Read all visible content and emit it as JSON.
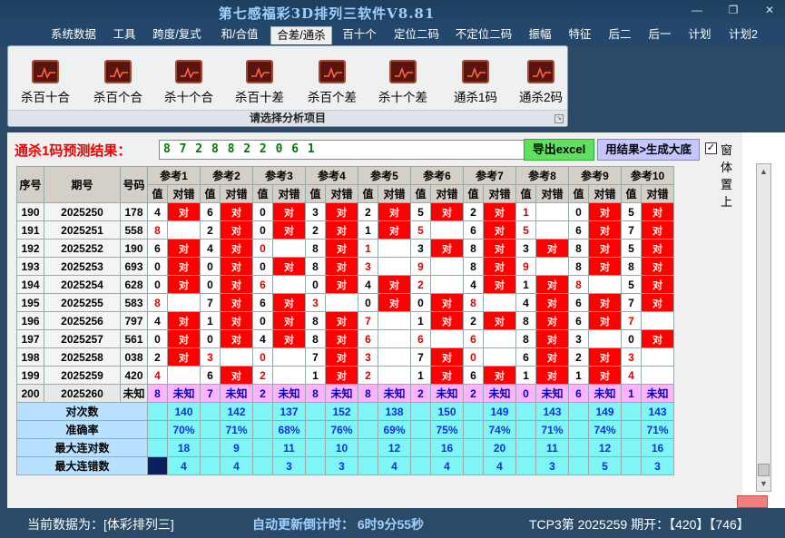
{
  "window": {
    "title": "第七感福彩3D排列三软件V8.81",
    "min_label": "—",
    "max_label": "❐",
    "close_label": "✕"
  },
  "menu": [
    "系统数据",
    "工具",
    "跨度/复式",
    "和/合值",
    "合差/通杀",
    "百十个",
    "定位二码",
    "不定位二码",
    "振幅",
    "特征",
    "后二",
    "后一",
    "计划",
    "计划2"
  ],
  "menu_active_index": 4,
  "ribbon": {
    "buttons": [
      "杀百十合",
      "杀百个合",
      "杀十个合",
      "杀百十差",
      "杀百个差",
      "杀十个差",
      "通杀1码",
      "通杀2码"
    ],
    "caption": "请选择分析项目"
  },
  "prediction": {
    "label": "通杀1码预测结果：",
    "value": "8 7 2 8 8 2 2 0 6 1"
  },
  "buttons": {
    "excel": "导出excel",
    "generate": "用结果>生成大底"
  },
  "checkbox": {
    "label": "窗体置上",
    "checked": true,
    "mark": "✓"
  },
  "table": {
    "col_headers": [
      "序号",
      "期号",
      "号码"
    ],
    "ref_headers": [
      "参考1",
      "参考2",
      "参考3",
      "参考4",
      "参考5",
      "参考6",
      "参考7",
      "参考8",
      "参考9",
      "参考10"
    ],
    "sub_val": "值",
    "sub_res": "对错",
    "hit_text": "对",
    "rows": [
      {
        "seq": "190",
        "period": "2025250",
        "number": "178",
        "vals": [
          "4",
          "6",
          "0",
          "3",
          "2",
          "5",
          "2",
          "1",
          "0",
          "5"
        ],
        "hits": [
          1,
          1,
          1,
          1,
          1,
          1,
          1,
          0,
          1,
          1
        ],
        "red": [
          0,
          0,
          0,
          0,
          0,
          0,
          0,
          1,
          0,
          0
        ]
      },
      {
        "seq": "191",
        "period": "2025251",
        "number": "558",
        "vals": [
          "8",
          "2",
          "0",
          "2",
          "1",
          "5",
          "6",
          "5",
          "6",
          "7"
        ],
        "hits": [
          0,
          1,
          1,
          1,
          1,
          0,
          1,
          0,
          1,
          1
        ],
        "red": [
          1,
          0,
          0,
          0,
          0,
          1,
          0,
          1,
          0,
          0
        ]
      },
      {
        "seq": "192",
        "period": "2025252",
        "number": "190",
        "vals": [
          "6",
          "4",
          "0",
          "8",
          "1",
          "3",
          "8",
          "3",
          "8",
          "5"
        ],
        "hits": [
          1,
          1,
          0,
          1,
          0,
          1,
          1,
          1,
          1,
          1
        ],
        "red": [
          0,
          0,
          1,
          0,
          1,
          0,
          0,
          0,
          0,
          0
        ]
      },
      {
        "seq": "193",
        "period": "2025253",
        "number": "693",
        "vals": [
          "0",
          "0",
          "0",
          "8",
          "3",
          "9",
          "8",
          "9",
          "8",
          "8"
        ],
        "hits": [
          1,
          1,
          1,
          1,
          0,
          0,
          1,
          0,
          1,
          1
        ],
        "red": [
          0,
          0,
          0,
          0,
          1,
          1,
          0,
          1,
          0,
          0
        ]
      },
      {
        "seq": "194",
        "period": "2025254",
        "number": "628",
        "vals": [
          "0",
          "0",
          "6",
          "0",
          "4",
          "2",
          "4",
          "1",
          "8",
          "5"
        ],
        "hits": [
          1,
          1,
          0,
          1,
          1,
          0,
          1,
          1,
          0,
          1
        ],
        "red": [
          0,
          0,
          1,
          0,
          0,
          1,
          0,
          0,
          1,
          0
        ]
      },
      {
        "seq": "195",
        "period": "2025255",
        "number": "583",
        "vals": [
          "8",
          "7",
          "6",
          "3",
          "0",
          "0",
          "8",
          "4",
          "6",
          "7"
        ],
        "hits": [
          0,
          1,
          1,
          0,
          1,
          1,
          0,
          1,
          1,
          1
        ],
        "red": [
          1,
          0,
          0,
          1,
          0,
          0,
          1,
          0,
          0,
          0
        ]
      },
      {
        "seq": "196",
        "period": "2025256",
        "number": "797",
        "vals": [
          "4",
          "1",
          "0",
          "8",
          "7",
          "1",
          "2",
          "8",
          "6",
          "7"
        ],
        "hits": [
          1,
          1,
          1,
          1,
          0,
          1,
          1,
          1,
          1,
          0
        ],
        "red": [
          0,
          0,
          0,
          0,
          1,
          0,
          0,
          0,
          0,
          1
        ]
      },
      {
        "seq": "197",
        "period": "2025257",
        "number": "561",
        "vals": [
          "0",
          "0",
          "4",
          "8",
          "6",
          "6",
          "6",
          "8",
          "3",
          "0"
        ],
        "hits": [
          1,
          1,
          1,
          1,
          0,
          0,
          0,
          1,
          0,
          1
        ],
        "red": [
          0,
          0,
          0,
          0,
          1,
          1,
          1,
          0,
          0,
          0
        ]
      },
      {
        "seq": "198",
        "period": "2025258",
        "number": "038",
        "vals": [
          "2",
          "3",
          "0",
          "7",
          "3",
          "7",
          "0",
          "6",
          "2",
          "3"
        ],
        "hits": [
          1,
          0,
          0,
          1,
          0,
          1,
          0,
          1,
          1,
          0
        ],
        "red": [
          0,
          1,
          1,
          0,
          1,
          0,
          1,
          0,
          0,
          1
        ]
      },
      {
        "seq": "199",
        "period": "2025259",
        "number": "420",
        "vals": [
          "4",
          "6",
          "2",
          "1",
          "2",
          "1",
          "6",
          "1",
          "1",
          "4"
        ],
        "hits": [
          0,
          1,
          0,
          1,
          0,
          1,
          1,
          1,
          1,
          0
        ],
        "red": [
          1,
          0,
          1,
          0,
          1,
          0,
          0,
          0,
          0,
          1
        ]
      }
    ],
    "pred_row": {
      "seq": "200",
      "period": "2025260",
      "number": "未知",
      "vals": [
        "8",
        "7",
        "2",
        "8",
        "8",
        "2",
        "2",
        "0",
        "6",
        "1"
      ],
      "res": "未知"
    },
    "stats": [
      {
        "label": "对次数",
        "values": [
          "140",
          "142",
          "137",
          "152",
          "138",
          "150",
          "149",
          "143",
          "149",
          "143"
        ]
      },
      {
        "label": "准确率",
        "values": [
          "70%",
          "71%",
          "68%",
          "76%",
          "69%",
          "75%",
          "74%",
          "71%",
          "74%",
          "71%"
        ]
      },
      {
        "label": "最大连对数",
        "values": [
          "18",
          "9",
          "11",
          "10",
          "12",
          "16",
          "20",
          "11",
          "12",
          "16"
        ]
      },
      {
        "label": "最大连错数",
        "values": [
          "4",
          "4",
          "3",
          "3",
          "4",
          "4",
          "4",
          "3",
          "5",
          "3"
        ]
      }
    ]
  },
  "status": {
    "source": "当前数据为：[体彩排列三]",
    "timer": "自动更新倒计时：  6时9分55秒",
    "tcp": "TCP3第 2025259 期开：【420】【746】"
  }
}
